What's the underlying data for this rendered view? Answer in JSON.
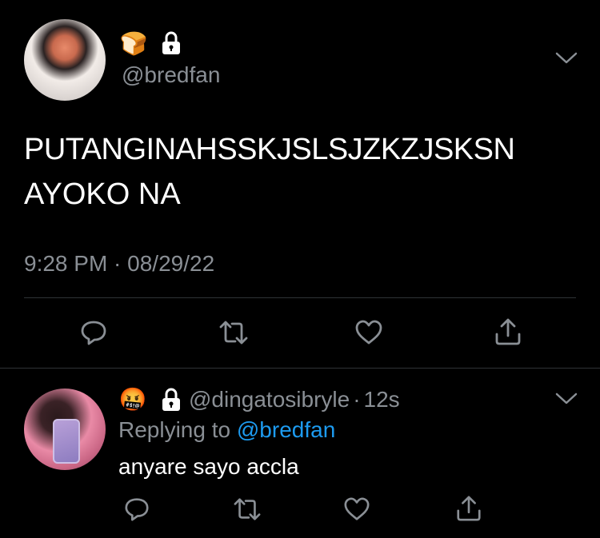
{
  "tweet": {
    "handle": "@bredfan",
    "name_emoji": "🍞",
    "text_line1": "PUTANGINAHSSKJSLSJZKZJSKSN",
    "text_line2": "AYOKO NA",
    "timestamp": "9:28 PM · 08/29/22"
  },
  "reply": {
    "name_emoji": "🤬",
    "handle": "@dingatosibryle",
    "separator": "·",
    "age": "12s",
    "replying_prefix": "Replying to ",
    "replying_handle": "@bredfan",
    "text": "anyare sayo accla"
  },
  "icons": {
    "reply": "reply-icon",
    "retweet": "retweet-icon",
    "like": "heart-icon",
    "share": "share-icon",
    "menu": "chevron-down-icon",
    "lock": "lock-icon"
  },
  "colors": {
    "background": "#000000",
    "text": "#ffffff",
    "secondary": "#8a8f95",
    "link": "#1d9bf0",
    "divider": "#2f3336"
  }
}
